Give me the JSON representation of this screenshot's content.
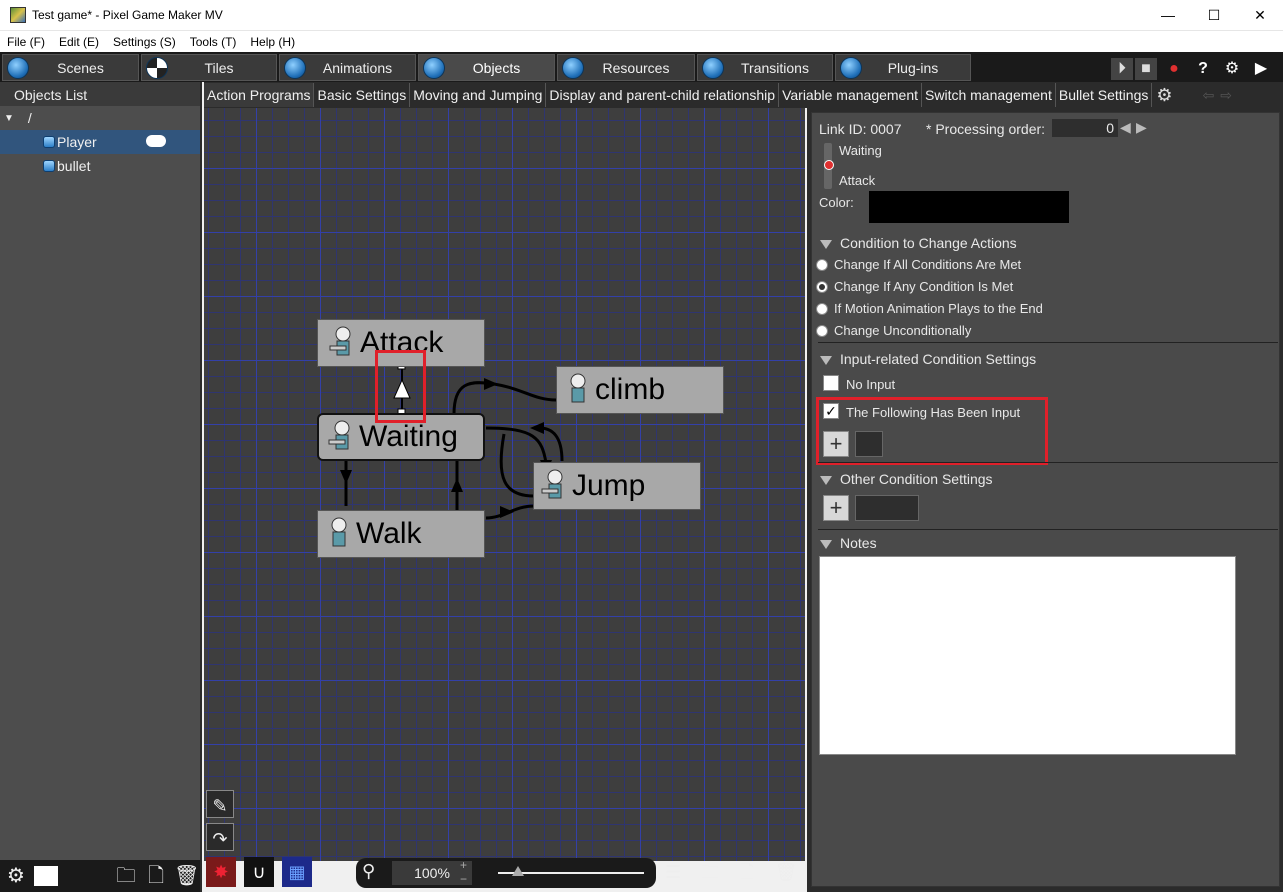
{
  "window": {
    "title": "Test game* - Pixel Game Maker MV",
    "minimize": "—",
    "maximize": "☐",
    "close": "✕"
  },
  "menu": [
    "File (F)",
    "Edit (E)",
    "Settings (S)",
    "Tools (T)",
    "Help (H)"
  ],
  "main_tabs": [
    "Scenes",
    "Tiles",
    "Animations",
    "Objects",
    "Resources",
    "Transitions",
    "Plug-ins"
  ],
  "active_main_tab": "Objects",
  "objects_list": {
    "header": "Objects List",
    "root": "/",
    "items": [
      "Player",
      "bullet"
    ],
    "selected": "Player"
  },
  "sub_tabs": [
    "Action Programs",
    "Basic Settings",
    "Moving and Jumping",
    "Display and parent-child relationship",
    "Variable management",
    "Switch management",
    "Bullet Settings"
  ],
  "nodes": {
    "attack": "Attack",
    "climb": "climb",
    "waiting": "Waiting",
    "jump": "Jump",
    "walk": "Walk"
  },
  "zoom": "100%",
  "link_panel": {
    "link_id": "Link ID: 0007",
    "processing_order_label": "* Processing order:",
    "processing_order_value": "0",
    "from": "Waiting",
    "to": "Attack",
    "color_label": "Color:",
    "color_value": "#000000"
  },
  "condition_change": {
    "header": "Condition to Change Actions",
    "options": [
      "Change If All Conditions Are Met",
      "Change If Any Condition Is Met",
      "If Motion Animation Plays to the End",
      "Change Unconditionally"
    ],
    "selected": "Change If Any Condition Is Met"
  },
  "input_conditions": {
    "header": "Input-related Condition Settings",
    "no_input": "No Input",
    "no_input_checked": false,
    "following_input": "The Following Has Been Input",
    "following_input_checked": true,
    "check_glyph": "✓"
  },
  "other_conditions": {
    "header": "Other Condition Settings"
  },
  "notes": {
    "header": "Notes",
    "value": ""
  },
  "plus_glyph": "+",
  "accent_red": "#e0202a"
}
